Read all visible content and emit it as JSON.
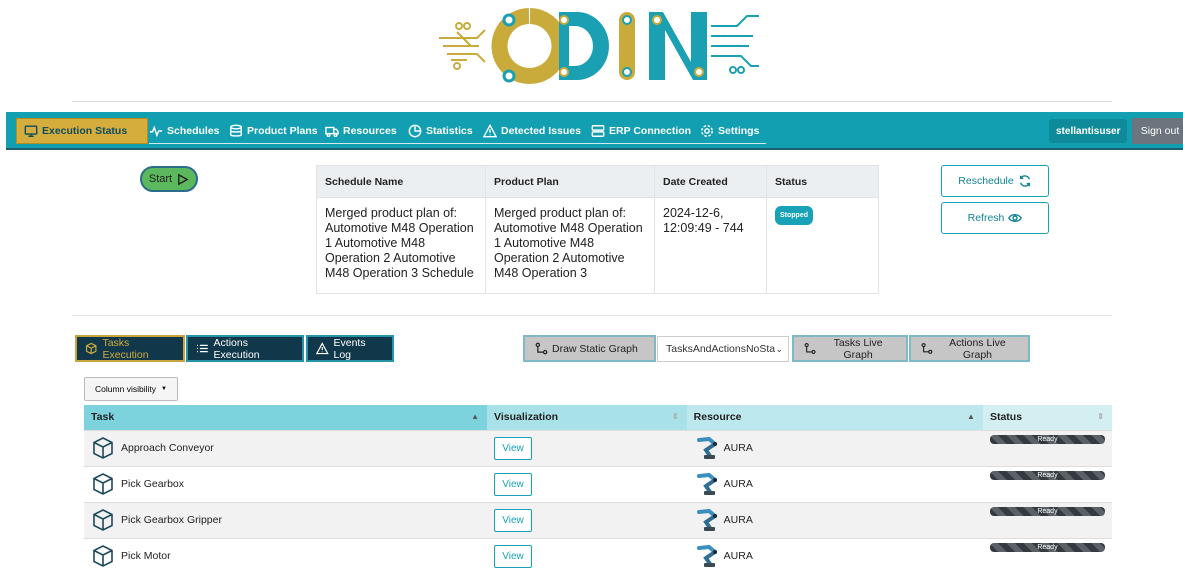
{
  "logo": {
    "text": "ODIN",
    "colors": {
      "gold": "#c9ab3b",
      "teal": "#1aa0b2"
    }
  },
  "navbar": {
    "items": [
      {
        "label": "Execution Status",
        "icon": "monitor-icon",
        "active": true
      },
      {
        "label": "Schedules",
        "icon": "activity-icon"
      },
      {
        "label": "Product Plans",
        "icon": "database-icon"
      },
      {
        "label": "Resources",
        "icon": "truck-icon"
      },
      {
        "label": "Statistics",
        "icon": "pie-chart-icon"
      },
      {
        "label": "Detected Issues",
        "icon": "warning-icon"
      },
      {
        "label": "ERP Connection",
        "icon": "server-icon"
      },
      {
        "label": "Settings",
        "icon": "gear-icon"
      }
    ],
    "user": "stellantisuser",
    "sign_out": "Sign out"
  },
  "start_label": "Start",
  "schedule": {
    "headers": [
      "Schedule Name",
      "Product Plan",
      "Date Created",
      "Status"
    ],
    "row": {
      "name": "Merged product plan of: Automotive M48 Operation 1 Automotive M48 Operation 2 Automotive M48 Operation 3 Schedule",
      "plan": "Merged product plan of: Automotive M48 Operation 1 Automotive M48 Operation 2 Automotive M48 Operation 3",
      "date": "2024-12-6, 12:09:49 - 744",
      "status": "Stopped"
    }
  },
  "buttons": {
    "reschedule": "Reschedule",
    "refresh": "Refresh"
  },
  "tabs": [
    {
      "label": "Tasks Execution",
      "icon": "cube-icon",
      "active": true
    },
    {
      "label": "Actions Execution",
      "icon": "list-icon"
    },
    {
      "label": "Events Log",
      "icon": "warning-icon"
    }
  ],
  "graph": {
    "draw_static": "Draw Static Graph",
    "select_value": "TasksAndActionsNoSta",
    "tasks_live": "Tasks Live Graph",
    "actions_live": "Actions Live Graph"
  },
  "column_visibility": "Column visibility",
  "table": {
    "headers": [
      "Task",
      "Visualization",
      "Resource",
      "Status"
    ],
    "rows": [
      {
        "task": "Approach Conveyor",
        "view": "View",
        "resource": "AURA",
        "status": "Ready"
      },
      {
        "task": "Pick Gearbox",
        "view": "View",
        "resource": "AURA",
        "status": "Ready"
      },
      {
        "task": "Pick Gearbox Gripper",
        "view": "View",
        "resource": "AURA",
        "status": "Ready"
      },
      {
        "task": "Pick Motor",
        "view": "View",
        "resource": "AURA",
        "status": "Ready"
      }
    ]
  }
}
